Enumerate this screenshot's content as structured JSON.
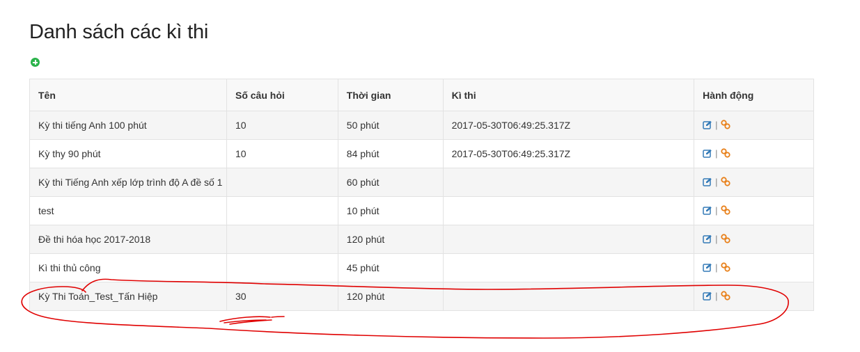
{
  "page": {
    "title": "Danh sách các kì thi",
    "add_icon": "plus-circle-icon"
  },
  "table": {
    "headers": {
      "name": "Tên",
      "questions": "Số câu hỏi",
      "time": "Thời gian",
      "exam": "Kì thi",
      "actions": "Hành động"
    },
    "rows": [
      {
        "name": "Kỳ thi tiếng Anh 100 phút",
        "questions": "10",
        "time": "50 phút",
        "exam": "2017-05-30T06:49:25.317Z"
      },
      {
        "name": "Kỳ thy 90 phút",
        "questions": "10",
        "time": "84 phút",
        "exam": "2017-05-30T06:49:25.317Z"
      },
      {
        "name": "Kỳ thi Tiếng Anh xếp lớp trình độ A đề số 1",
        "questions": "",
        "time": "60 phút",
        "exam": ""
      },
      {
        "name": "test",
        "questions": "",
        "time": "10 phút",
        "exam": ""
      },
      {
        "name": "Đề thi hóa học 2017-2018",
        "questions": "",
        "time": "120 phút",
        "exam": ""
      },
      {
        "name": "Kì thi thủ công",
        "questions": "",
        "time": "45 phút",
        "exam": ""
      },
      {
        "name": "Kỳ Thi Toán_Test_Tấn Hiệp",
        "questions": "30",
        "time": "120 phút",
        "exam": ""
      }
    ],
    "action_separator": "|",
    "action_icons": [
      "edit-icon",
      "link-icon"
    ]
  },
  "colors": {
    "add_icon": "#2bb34b",
    "edit_icon": "#337ab7",
    "link_icon": "#e8801a",
    "annotation": "#e00000"
  }
}
